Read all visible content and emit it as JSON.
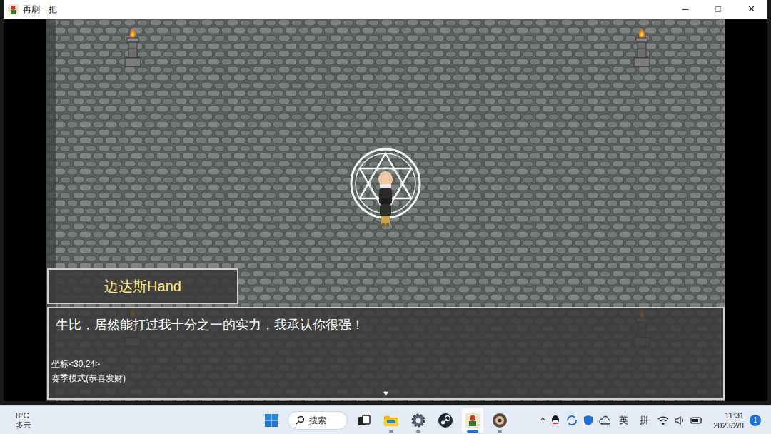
{
  "window": {
    "title": "再刷一把",
    "controls": [
      "─",
      "□",
      "✕"
    ]
  },
  "game": {
    "speaker": "迈达斯Hand",
    "message": "牛比，居然能打过我十分之一的实力，我承认你很强！",
    "coords": "坐标<30,24>",
    "mode": "赛季模式(恭喜发财)",
    "continue_marker": "▼"
  },
  "taskbar": {
    "weather": {
      "temp": "8°C",
      "condition": "多云"
    },
    "search": {
      "placeholder": "搜索"
    },
    "apps": [
      {
        "kind": "start",
        "running": false,
        "active": false
      },
      {
        "kind": "taskview",
        "running": false,
        "active": false
      },
      {
        "kind": "explorer",
        "running": true,
        "active": false
      },
      {
        "kind": "settings",
        "running": true,
        "active": false
      },
      {
        "kind": "steam",
        "running": false,
        "active": false
      },
      {
        "kind": "game",
        "running": true,
        "active": true
      },
      {
        "kind": "ball",
        "running": true,
        "active": false
      }
    ],
    "tray": {
      "overflow": "^",
      "ime_lang": "英",
      "ime_mode": "拼"
    },
    "clock": {
      "time": "11:31",
      "date": "2023/2/8"
    },
    "notifications": "1"
  }
}
